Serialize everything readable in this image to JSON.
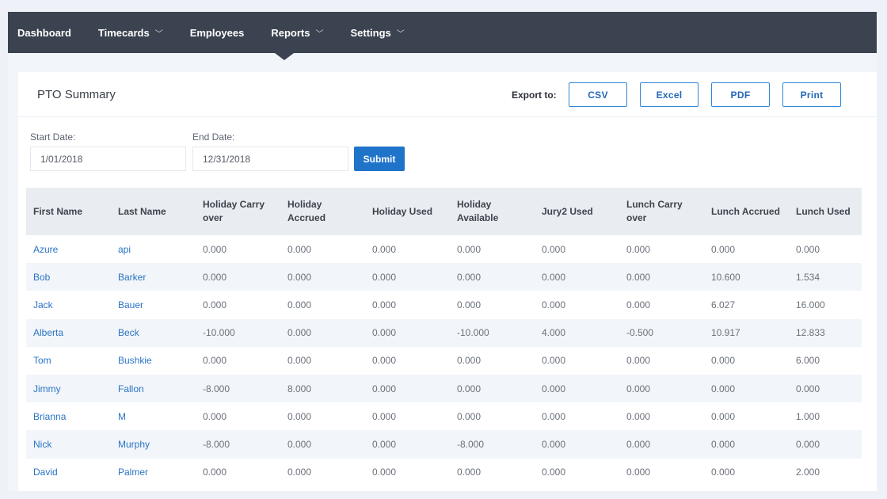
{
  "nav": {
    "items": [
      {
        "label": "Dashboard",
        "has_menu": false
      },
      {
        "label": "Timecards",
        "has_menu": true
      },
      {
        "label": "Employees",
        "has_menu": false
      },
      {
        "label": "Reports",
        "has_menu": true,
        "active": true
      },
      {
        "label": "Settings",
        "has_menu": true
      }
    ],
    "chevron_glyph": "﹀"
  },
  "card": {
    "title": "PTO Summary",
    "export_label": "Export to:",
    "export_buttons": [
      "CSV",
      "Excel",
      "PDF",
      "Print"
    ]
  },
  "filters": {
    "start_label": "Start Date:",
    "start_value": "1/01/2018",
    "end_label": "End Date:",
    "end_value": "12/31/2018",
    "submit_label": "Submit"
  },
  "table": {
    "headers": [
      "First Name",
      "Last Name",
      "Holiday Carry over",
      "Holiday Accrued",
      "Holiday Used",
      "Holiday Available",
      "Jury2 Used",
      "Lunch Carry over",
      "Lunch Accrued",
      "Lunch Used"
    ],
    "rows": [
      [
        "Azure",
        "api",
        "0.000",
        "0.000",
        "0.000",
        "0.000",
        "0.000",
        "0.000",
        "0.000",
        "0.000"
      ],
      [
        "Bob",
        "Barker",
        "0.000",
        "0.000",
        "0.000",
        "0.000",
        "0.000",
        "0.000",
        "10.600",
        "1.534"
      ],
      [
        "Jack",
        "Bauer",
        "0.000",
        "0.000",
        "0.000",
        "0.000",
        "0.000",
        "0.000",
        "6.027",
        "16.000"
      ],
      [
        "Alberta",
        "Beck",
        "-10.000",
        "0.000",
        "0.000",
        "-10.000",
        "4.000",
        "-0.500",
        "10.917",
        "12.833"
      ],
      [
        "Tom",
        "Bushkie",
        "0.000",
        "0.000",
        "0.000",
        "0.000",
        "0.000",
        "0.000",
        "0.000",
        "6.000"
      ],
      [
        "Jimmy",
        "Fallon",
        "-8.000",
        "8.000",
        "0.000",
        "0.000",
        "0.000",
        "0.000",
        "0.000",
        "0.000"
      ],
      [
        "Brianna",
        "M",
        "0.000",
        "0.000",
        "0.000",
        "0.000",
        "0.000",
        "0.000",
        "0.000",
        "1.000"
      ],
      [
        "Nick",
        "Murphy",
        "-8.000",
        "0.000",
        "0.000",
        "-8.000",
        "0.000",
        "0.000",
        "0.000",
        "0.000"
      ],
      [
        "David",
        "Palmer",
        "0.000",
        "0.000",
        "0.000",
        "0.000",
        "0.000",
        "0.000",
        "0.000",
        "2.000"
      ]
    ]
  },
  "colors": {
    "navbar": "#3b4350",
    "accent": "#1f73c9",
    "link": "#2a74c6"
  }
}
